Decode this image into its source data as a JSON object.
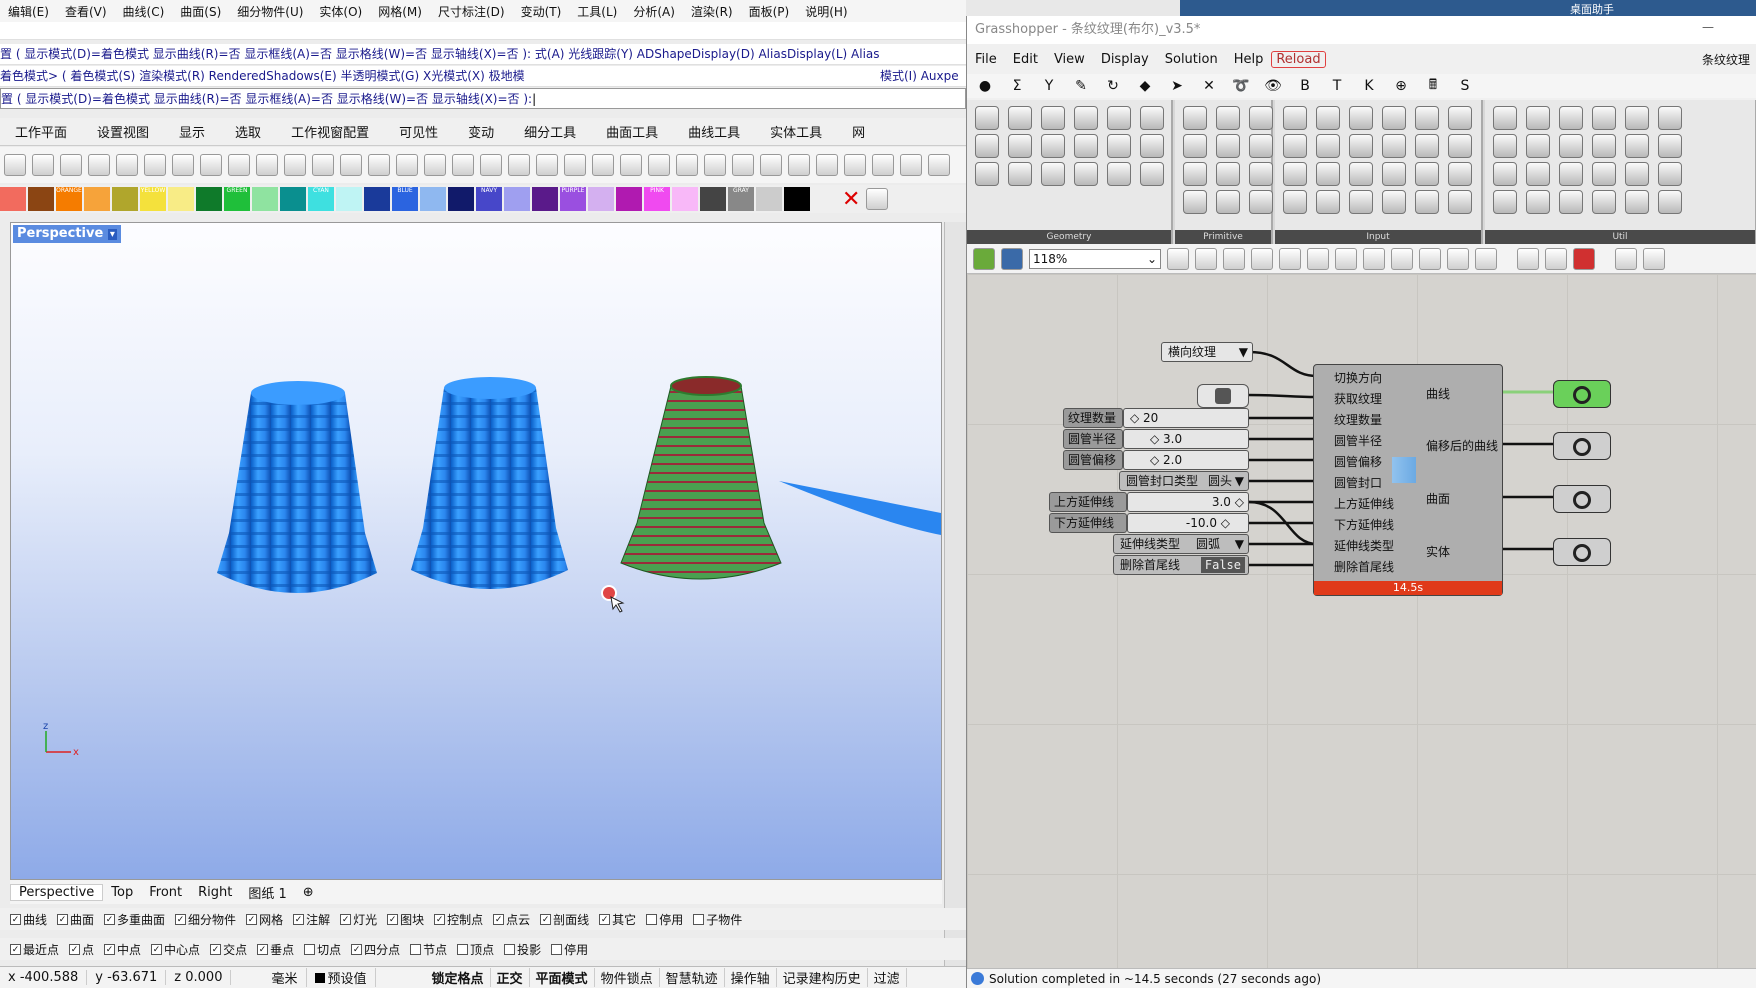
{
  "rhino": {
    "menu": [
      "编辑(E)",
      "查看(V)",
      "曲线(C)",
      "曲面(S)",
      "细分物件(U)",
      "实体(O)",
      "网格(M)",
      "尺寸标注(D)",
      "变动(T)",
      "工具(L)",
      "分析(A)",
      "渲染(R)",
      "面板(P)",
      "说明(H)"
    ],
    "cmd1": "置 ( 显示模式(D)=着色模式  显示曲线(R)=否  显示框线(A)=否  显示格线(W)=否  显示轴线(X)=否 ): 式(A)  光线跟踪(Y)  ADShapeDisplay(D)  AliasDisplay(L)  Alias",
    "cmd2": "着色模式> ( 着色模式(S)  渲染模式(R)  RenderedShadows(E)  半透明模式(G)  X光模式(X)  极地模",
    "cmd2_right": "模式(I)  Auxpe",
    "cmd3": "置 ( 显示模式(D)=着色模式  显示曲线(R)=否  显示框线(A)=否  显示格线(W)=否  显示轴线(X)=否 ):",
    "tabs": [
      "工作平面",
      "设置视图",
      "显示",
      "选取",
      "工作视窗配置",
      "可见性",
      "变动",
      "细分工具",
      "曲面工具",
      "曲线工具",
      "实体工具",
      "网"
    ],
    "viewport_title": "Perspective",
    "vp_tabs": [
      "Perspective",
      "Top",
      "Front",
      "Right",
      "图纸 1"
    ],
    "osnap1": [
      [
        "曲线",
        true
      ],
      [
        "曲面",
        true
      ],
      [
        "多重曲面",
        true
      ],
      [
        "细分物件",
        true
      ],
      [
        "网格",
        true
      ],
      [
        "注解",
        true
      ],
      [
        "灯光",
        true
      ],
      [
        "图块",
        true
      ],
      [
        "控制点",
        true
      ],
      [
        "点云",
        true
      ],
      [
        "剖面线",
        true
      ],
      [
        "其它",
        true
      ],
      [
        "停用",
        false
      ],
      [
        "子物件",
        false
      ]
    ],
    "osnap2": [
      [
        "最近点",
        true
      ],
      [
        "点",
        true
      ],
      [
        "中点",
        true
      ],
      [
        "中心点",
        true
      ],
      [
        "交点",
        true
      ],
      [
        "垂点",
        true
      ],
      [
        "切点",
        false
      ],
      [
        "四分点",
        true
      ],
      [
        "节点",
        false
      ],
      [
        "顶点",
        false
      ],
      [
        "投影",
        false
      ],
      [
        "停用",
        false
      ]
    ],
    "status": {
      "x": "x -400.588",
      "y": "y -63.671",
      "z": "z 0.000",
      "unit": "毫米",
      "layer": "预设值",
      "items": [
        "锁定格点",
        "正交",
        "平面模式",
        "物件锁点",
        "智慧轨迹",
        "操作轴",
        "记录建构历史",
        "过滤"
      ]
    },
    "colors": [
      {
        "c": "#f26b5e",
        "t": ""
      },
      {
        "c": "#8b4513",
        "t": ""
      },
      {
        "c": "#f57c00",
        "t": "ORANGE"
      },
      {
        "c": "#f6a33a",
        "t": ""
      },
      {
        "c": "#b0a62c",
        "t": ""
      },
      {
        "c": "#f4e13c",
        "t": "YELLOW"
      },
      {
        "c": "#f8ec86",
        "t": ""
      },
      {
        "c": "#0f7a2a",
        "t": ""
      },
      {
        "c": "#1fbf3a",
        "t": "GREEN"
      },
      {
        "c": "#8fe3a0",
        "t": ""
      },
      {
        "c": "#0a8f8f",
        "t": ""
      },
      {
        "c": "#3ee0e0",
        "t": "CYAN"
      },
      {
        "c": "#bff4f4",
        "t": ""
      },
      {
        "c": "#1a3a9a",
        "t": ""
      },
      {
        "c": "#2b64e0",
        "t": "BLUE"
      },
      {
        "c": "#8fb8f0",
        "t": ""
      },
      {
        "c": "#111a6a",
        "t": ""
      },
      {
        "c": "#4747c9",
        "t": "NAVY"
      },
      {
        "c": "#9f9ff0",
        "t": ""
      },
      {
        "c": "#5a1a8a",
        "t": ""
      },
      {
        "c": "#9a4fe0",
        "t": "PURPLE"
      },
      {
        "c": "#d4b0f0",
        "t": ""
      },
      {
        "c": "#b01ab0",
        "t": ""
      },
      {
        "c": "#f04af0",
        "t": "PINK"
      },
      {
        "c": "#f8b8f8",
        "t": ""
      },
      {
        "c": "#444444",
        "t": ""
      },
      {
        "c": "#888888",
        "t": "GRAY"
      },
      {
        "c": "#cccccc",
        "t": ""
      },
      {
        "c": "#000000",
        "t": ""
      }
    ]
  },
  "gh": {
    "title": "Grasshopper - 条纹纹理(布尔)_v3.5*",
    "menu": [
      "File",
      "Edit",
      "View",
      "Display",
      "Solution",
      "Help"
    ],
    "reload": "Reload",
    "right_label": "条纹纹理",
    "categories": [
      "●",
      "Σ",
      "Y",
      "✎",
      "↻",
      "◆",
      "➤",
      "✕",
      "➰",
      "👁",
      "B",
      "T",
      "K",
      "⊕",
      "🖩",
      "S"
    ],
    "panel_names": [
      "Geometry",
      "Primitive",
      "Input",
      "Util"
    ],
    "zoom": "118%",
    "inputs": {
      "texture_mode": "横向纹理",
      "count_label": "纹理数量",
      "count_value": "◇ 20",
      "radius_label": "圆管半径",
      "radius_value": "◇ 3.0",
      "offset_label": "圆管偏移",
      "offset_value": "◇ 2.0",
      "cap_label": "圆管封口类型",
      "cap_value": "圆头",
      "up_label": "上方延伸线",
      "up_value": "3.0 ◇",
      "down_label": "下方延伸线",
      "down_value": "-10.0 ◇",
      "ext_label": "延伸线类型",
      "ext_value": "圆弧",
      "del_label": "删除首尾线",
      "del_value": "False"
    },
    "cluster": {
      "in": [
        "切换方向",
        "获取纹理",
        "纹理数量",
        "圆管半径",
        "圆管偏移",
        "圆管封口",
        "上方延伸线",
        "下方延伸线",
        "延伸线类型",
        "删除首尾线"
      ],
      "out": [
        "曲线",
        "偏移后的曲线",
        "曲面",
        "实体"
      ],
      "time": "14.5s"
    },
    "status": "Solution completed in ~14.5 seconds (27 seconds ago)"
  },
  "desktop": {
    "label": "桌面助手"
  }
}
